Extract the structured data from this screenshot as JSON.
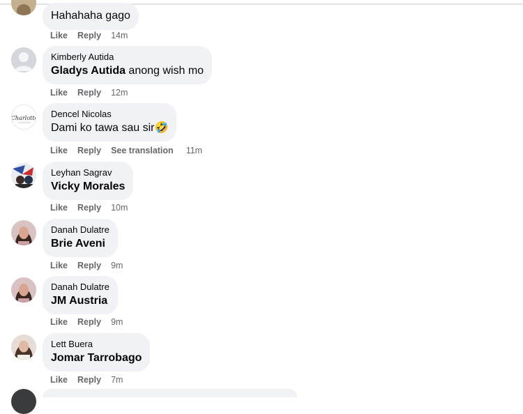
{
  "comments": [
    {
      "author": "",
      "tag": "",
      "text": "Hahahaha gago",
      "like": "Like",
      "reply": "Reply",
      "translate": "",
      "time": "14m"
    },
    {
      "author": "Kimberly Autida",
      "tag": "Gladys Autida",
      "text": " anong wish mo",
      "like": "Like",
      "reply": "Reply",
      "translate": "",
      "time": "12m"
    },
    {
      "author": "Dencel Nicolas",
      "tag": "",
      "text": "Dami ko tawa sau sir🤣",
      "like": "Like",
      "reply": "Reply",
      "translate": "See translation",
      "time": "11m"
    },
    {
      "author": "Leyhan Sagrav",
      "tag": "Vicky Morales",
      "text": "",
      "like": "Like",
      "reply": "Reply",
      "translate": "",
      "time": "10m"
    },
    {
      "author": "Danah Dulatre",
      "tag": "Brie Aveni",
      "text": "",
      "like": "Like",
      "reply": "Reply",
      "translate": "",
      "time": "9m"
    },
    {
      "author": "Danah Dulatre",
      "tag": "JM Austria",
      "text": "",
      "like": "Like",
      "reply": "Reply",
      "translate": "",
      "time": "9m"
    },
    {
      "author": "Lett Buera",
      "tag": "Jomar Tarrobago",
      "text": "",
      "like": "Like",
      "reply": "Reply",
      "translate": "",
      "time": "7m"
    }
  ],
  "avatars": {
    "0": "user-photo-icon",
    "1": "default-avatar-icon",
    "2": "charlotte-logo-icon",
    "3": "user-photo-icon",
    "4": "user-photo-icon",
    "5": "user-photo-icon",
    "6": "user-photo-icon"
  },
  "logo_text": "Charlotte"
}
